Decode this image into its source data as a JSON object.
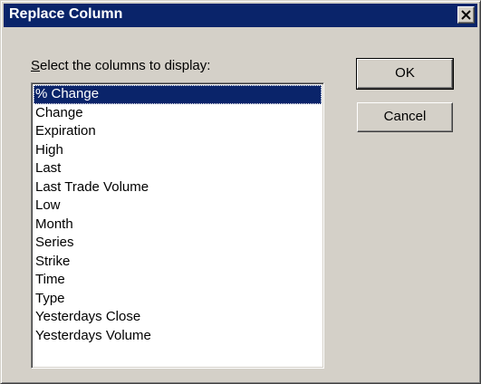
{
  "window": {
    "title": "Replace Column",
    "close_glyph": "close-icon"
  },
  "prompt": {
    "accel": "S",
    "rest": "elect the columns to display:"
  },
  "list": {
    "selected_index": 0,
    "items": [
      "% Change",
      "Change",
      "Expiration",
      "High",
      "Last",
      "Last Trade Volume",
      "Low",
      "Month",
      "Series",
      "Strike",
      "Time",
      "Type",
      "Yesterdays Close",
      "Yesterdays Volume"
    ]
  },
  "buttons": {
    "ok_label": "OK",
    "cancel_label": "Cancel"
  },
  "colors": {
    "titlebar": "#0a246a",
    "face": "#d4d0c8",
    "selection": "#0a246a"
  }
}
